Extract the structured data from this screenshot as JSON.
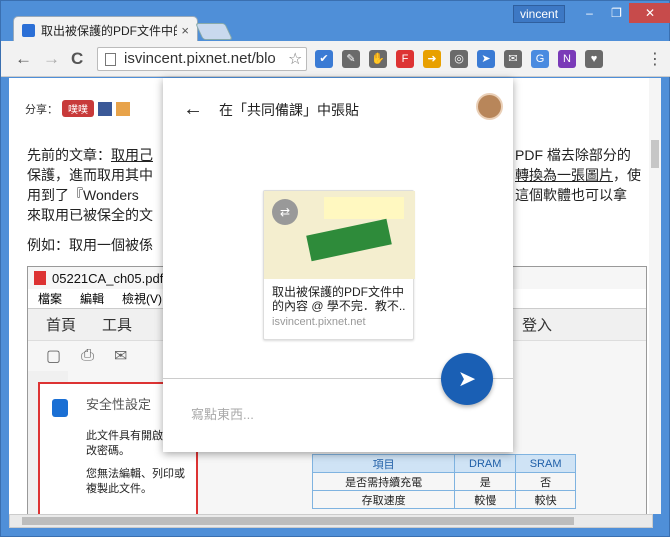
{
  "browser": {
    "tab_title": "取出被保護的PDF文件中的",
    "tab_close": "×",
    "user": "vincent",
    "window_controls": [
      "–",
      "❐",
      "✕"
    ],
    "url": "isvincent.pixnet.net/blo",
    "back": "←",
    "forward": "→",
    "reload": "C",
    "star": "☆",
    "menu": "⋮",
    "extensions": [
      {
        "name": "checkbox-ext-icon",
        "label": "✔",
        "color": "#3b7bd4"
      },
      {
        "name": "feather-ext-icon",
        "label": "✎",
        "color": "#6a6a6a"
      },
      {
        "name": "hand-ext-icon",
        "label": "✋",
        "color": "#6a6a6a"
      },
      {
        "name": "flipboard-ext-icon",
        "label": "F",
        "color": "#d33"
      },
      {
        "name": "arrow-ext-icon",
        "label": "➜",
        "color": "#e8a000"
      },
      {
        "name": "bulb-ext-icon",
        "label": "◎",
        "color": "#6a6a6a"
      },
      {
        "name": "send-ext-icon",
        "label": "➤",
        "color": "#3b7bd4"
      },
      {
        "name": "mail-ext-icon",
        "label": "✉",
        "color": "#6a6a6a"
      },
      {
        "name": "translate-ext-icon",
        "label": "G",
        "color": "#4a8be0"
      },
      {
        "name": "onenote-ext-icon",
        "label": "N",
        "color": "#7a3ab8"
      },
      {
        "name": "pocket-ext-icon",
        "label": "♥",
        "color": "#6a6a6a"
      }
    ]
  },
  "page": {
    "share_label": "分享：",
    "plurk": "噗噗",
    "para1_line1": "先前的文章：",
    "para1_link1": "取用己",
    "para1_tail1": "PDF 檔去除部分的",
    "para1_line2": "保護，進而取用其中",
    "para1_link2": "轉換為一張圖片",
    "para1_tail2": "，使",
    "para1_line3": "用到了『Wonders",
    "para1_tail3": "這個軟體也可以拿",
    "para1_line4": "來取用已被保全的文",
    "para2": "例如：取用一個被係"
  },
  "pdf": {
    "title": "05221CA_ch05.pdf (",
    "menu": [
      "檔案",
      "編輯",
      "檢視(V)"
    ],
    "bar": [
      "首頁",
      "工具"
    ],
    "help": "?",
    "login": "登入",
    "more": "•••",
    "security_header": "安全性設定",
    "sec_p1": "此文件具有開啟或修改密碼。",
    "sec_p2": "您無法編輯、列印或複製此文件。",
    "table_headers": [
      "項目",
      "DRAM",
      "SRAM"
    ],
    "table_rows": [
      [
        "是否需持續充電",
        "是",
        "否"
      ],
      [
        "存取速度",
        "較慢",
        "較快"
      ]
    ]
  },
  "dialog": {
    "title": "在「共同備課」中張貼",
    "back": "←",
    "card_title_line1": "取出被保護的PDF文件中",
    "card_title_line2": "的內容 @ 學不完．教不..",
    "card_url": "isvincent.pixnet.net",
    "send": "➤",
    "placeholder": "寫點東西..."
  }
}
